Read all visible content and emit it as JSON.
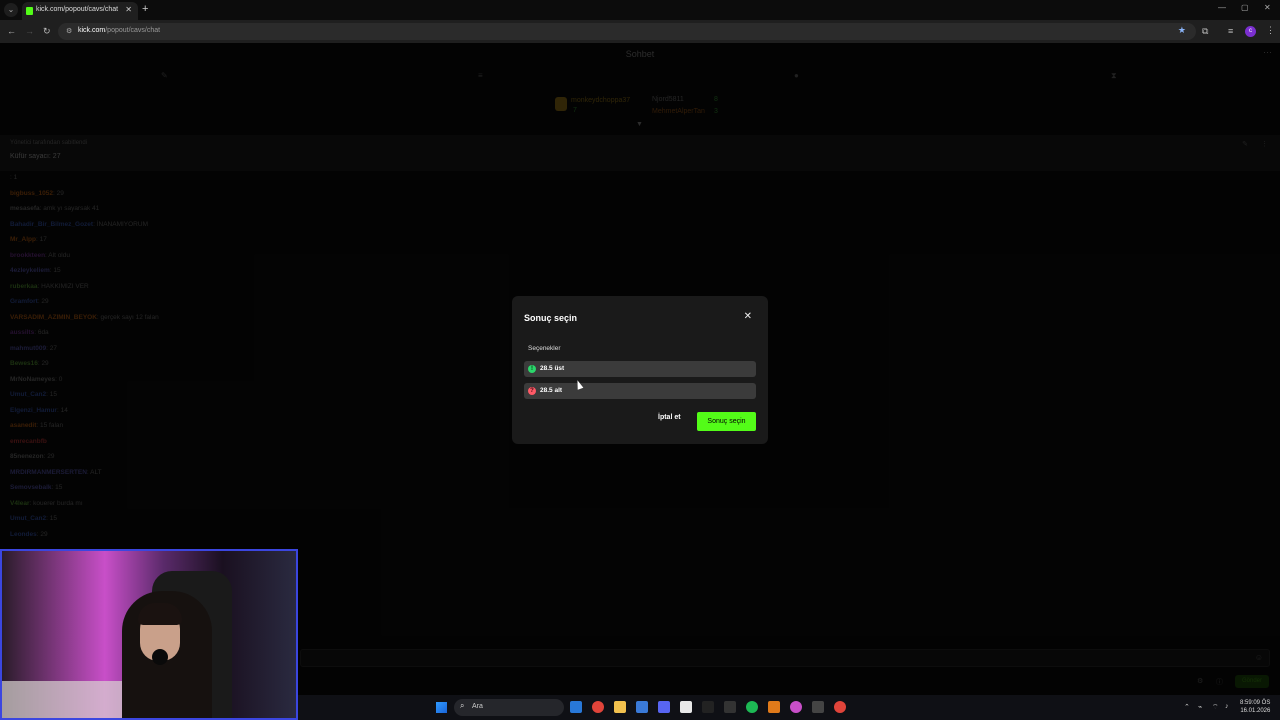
{
  "browser": {
    "tab_title": "kick.com/popout/cavs/chat",
    "url_host": "kick.com",
    "url_path": "/popout/cavs/chat",
    "profile_initial": "c"
  },
  "chat": {
    "title": "Sohbet",
    "leaderboard": [
      {
        "name": "monkeydchoppa37",
        "value": "7"
      },
      {
        "name": "Njord5811",
        "value": "8"
      },
      {
        "name": "MehmetAlperTan",
        "value": "3"
      }
    ],
    "pinned": {
      "line1": "Yönetici tarafından sabitlendi",
      "line2": "Küfür sayacı: 27"
    },
    "messages": [
      {
        "user": "",
        "text": ": 1",
        "color": "#1b2a55"
      },
      {
        "user": "bigbuss_1052",
        "text": ": 29",
        "color": "#5a2e0a"
      },
      {
        "user": "mesasefa",
        "text": ": amk yı sayarsak 41",
        "color": "#3a3a3a"
      },
      {
        "user": "Bahadir_Bir_Bilmez_Gozet",
        "text": ": İNANAMIYORUM",
        "color": "#1b2a55"
      },
      {
        "user": "Mr_Alpp",
        "text": ": 17",
        "color": "#5a2e0a"
      },
      {
        "user": "brookkteen",
        "text": ": Alt oldu",
        "color": "#3a1a4a"
      },
      {
        "user": "4ezleykeliem",
        "text": ": 15",
        "color": "#2a2a55"
      },
      {
        "user": "ruberkaa",
        "text": ": HAKKIMIZI VER",
        "color": "#2a4a1a"
      },
      {
        "user": "Gramfort",
        "text": ": 29",
        "color": "#1b2a55"
      },
      {
        "user": "VARSADIM_AZIMIN_BEYOK",
        "text": ": gerçek sayı 12 falan",
        "color": "#5a2e0a"
      },
      {
        "user": "aussilts",
        "text": ": 6da",
        "color": "#3a1a4a"
      },
      {
        "user": "mahmut009",
        "text": ": 27",
        "color": "#2a2a55"
      },
      {
        "user": "Bewes16",
        "text": ": 29",
        "color": "#2a4a1a"
      },
      {
        "user": "MrNoNameyes",
        "text": ": 0",
        "color": "#3a3a3a"
      },
      {
        "user": "Umut_Can2",
        "text": ": 15",
        "color": "#1b2a55"
      },
      {
        "user": "Elgenzi_Hamur",
        "text": ": 14",
        "color": "#1b2a55"
      },
      {
        "user": "asanedit",
        "text": ": 15 falan",
        "color": "#5a2e0a"
      },
      {
        "user": "emrecanbfb",
        "text": "",
        "color": "#5a1a1a"
      },
      {
        "user": "85nenezon",
        "text": ": 29",
        "color": "#3a3a3a"
      },
      {
        "user": "MRDIRMANMERSERTEN",
        "text": ": ALT",
        "color": "#2a2a55"
      },
      {
        "user": "Semovsebalk",
        "text": ": 15",
        "color": "#2a2a55"
      },
      {
        "user": "V4lear",
        "text": ": kouerer burda mı",
        "color": "#2a4a1a"
      },
      {
        "user": "Umut_Can2",
        "text": ": 15",
        "color": "#1b2a55"
      },
      {
        "user": "Leondes",
        "text": ": 29",
        "color": "#1b2a55"
      }
    ],
    "send_label": "Gönder"
  },
  "modal": {
    "title": "Sonuç seçin",
    "options_label": "Seçenekler",
    "options": [
      {
        "label": "28.5 üst",
        "icon": "!",
        "icon_color": "#2bd66b"
      },
      {
        "label": "28.5 alt",
        "icon": "?",
        "icon_color": "#ff5a67"
      }
    ],
    "cancel_label": "İptal et",
    "confirm_label": "Sonuç seçin",
    "accent": "#53fc18"
  },
  "taskbar": {
    "search_placeholder": "Ara",
    "time": "8:59:09 ÖS",
    "date": "16.01.2026"
  }
}
